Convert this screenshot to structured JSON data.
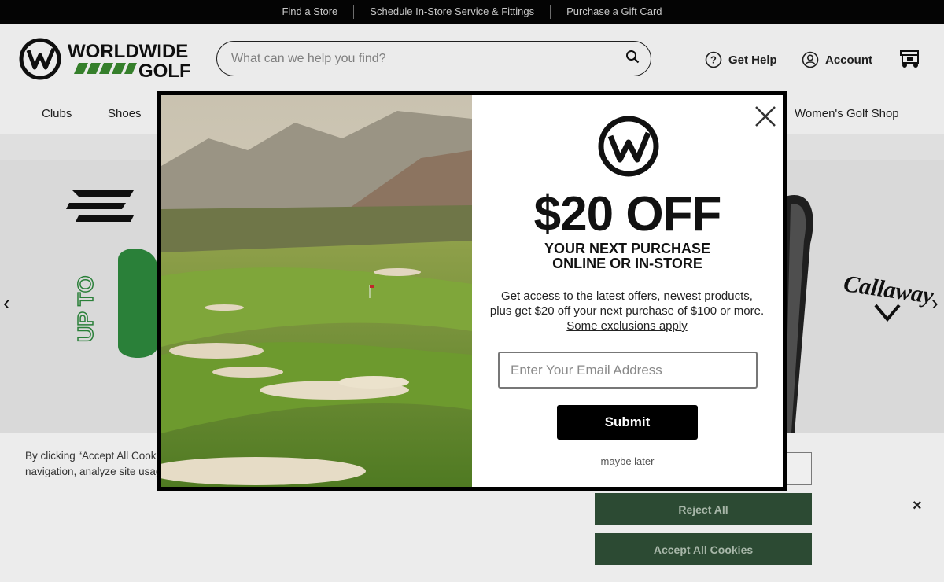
{
  "utility_bar": {
    "links": [
      "Find a Store",
      "Schedule In-Store Service & Fittings",
      "Purchase a Gift Card"
    ]
  },
  "header": {
    "logo_line1": "WORLDWIDE",
    "logo_line2": "GOLF",
    "search_placeholder": "What can we help you find?",
    "get_help": "Get Help",
    "account": "Account"
  },
  "nav": {
    "items": [
      "Clubs",
      "Shoes",
      "Women's Golf Shop"
    ]
  },
  "hero": {
    "left_arrow": "‹",
    "right_arrow": "›",
    "brand_text": "Callaway"
  },
  "modal": {
    "headline": "$20 OFF",
    "sub_line1": "YOUR NEXT PURCHASE",
    "sub_line2": "ONLINE OR IN-STORE",
    "description": "Get access to the latest offers, newest products, plus get $20 off your next purchase of $100 or more.",
    "exclusions_link": "Some exclusions apply",
    "email_placeholder": "Enter Your Email Address",
    "submit_label": "Submit",
    "maybe_later": "maybe later"
  },
  "cookie_banner": {
    "text_line1": "By clicking “Accept All Cookies”, you agree to the storing of cookies on your device to enhance site",
    "text_line2": "navigation, analyze site usage, and assist in our marketing efforts.",
    "reject_label": "Reject All",
    "accept_label": "Accept All Cookies",
    "close_glyph": "×"
  },
  "colors": {
    "accent_green": "#2e8b3e",
    "cookie_button": "#2c4a33",
    "black": "#000000"
  }
}
